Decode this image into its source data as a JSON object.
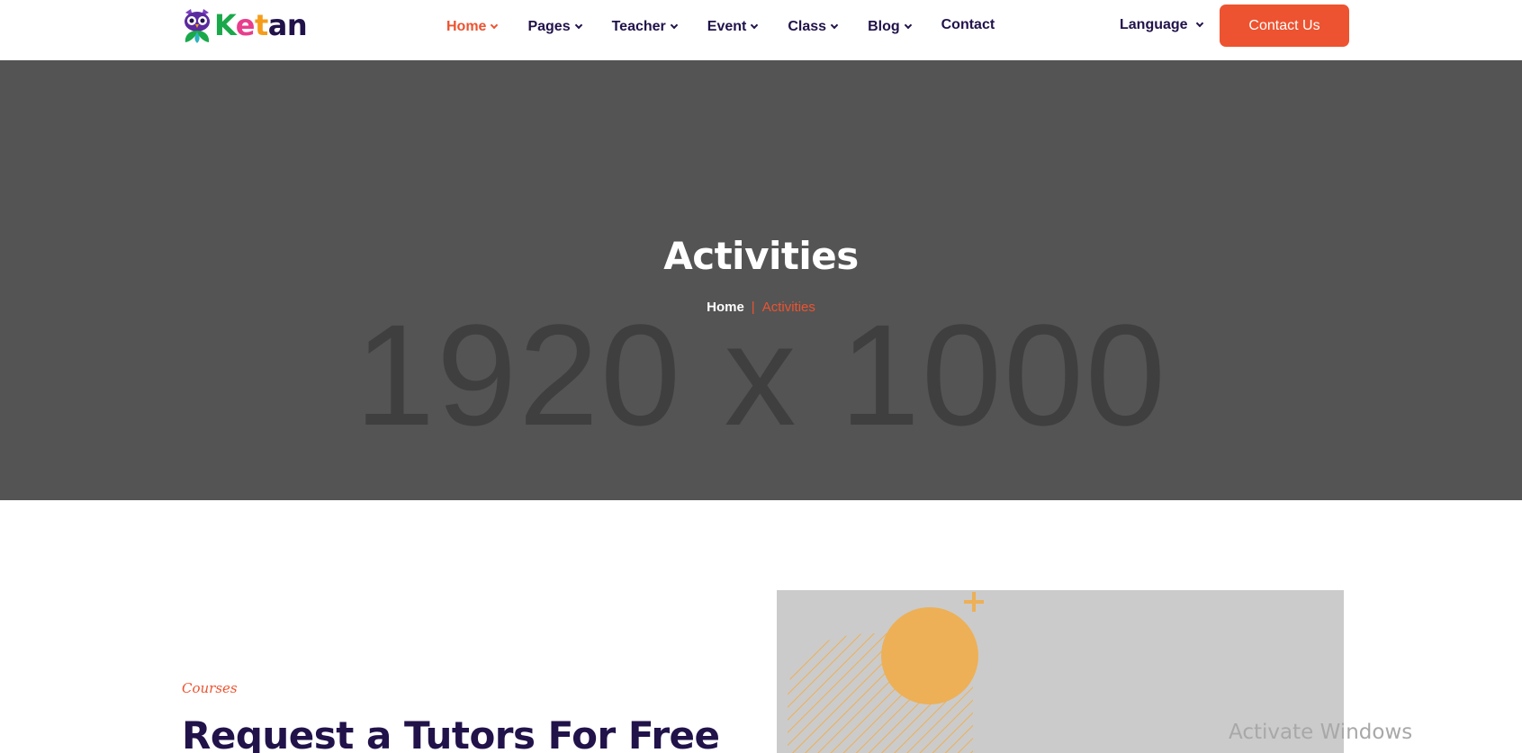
{
  "header": {
    "logo": {
      "text": [
        "K",
        "e",
        "t",
        "a",
        "n"
      ]
    },
    "nav": [
      {
        "label": "Home",
        "active": true,
        "dropdown": true
      },
      {
        "label": "Pages",
        "active": false,
        "dropdown": true
      },
      {
        "label": "Teacher",
        "active": false,
        "dropdown": true
      },
      {
        "label": "Event",
        "active": false,
        "dropdown": true
      },
      {
        "label": "Class",
        "active": false,
        "dropdown": true
      },
      {
        "label": "Blog",
        "active": false,
        "dropdown": true
      },
      {
        "label": "Contact",
        "active": false,
        "dropdown": false
      }
    ],
    "language_label": "Language",
    "contact_button": "Contact Us"
  },
  "hero": {
    "placeholder_text": "1920 x 1000",
    "title": "Activities",
    "breadcrumb": {
      "home": "Home",
      "separator": "|",
      "current": "Activities"
    }
  },
  "section": {
    "tag": "Courses",
    "title": "Request a Tutors For Free"
  },
  "os_watermark": "Activate Windows",
  "colors": {
    "accent": "#ed5330",
    "dark_text": "#21124a",
    "hero_bg": "#545454",
    "image_placeholder_bg": "#cbcbcb",
    "shape_orange": "#edb056"
  }
}
